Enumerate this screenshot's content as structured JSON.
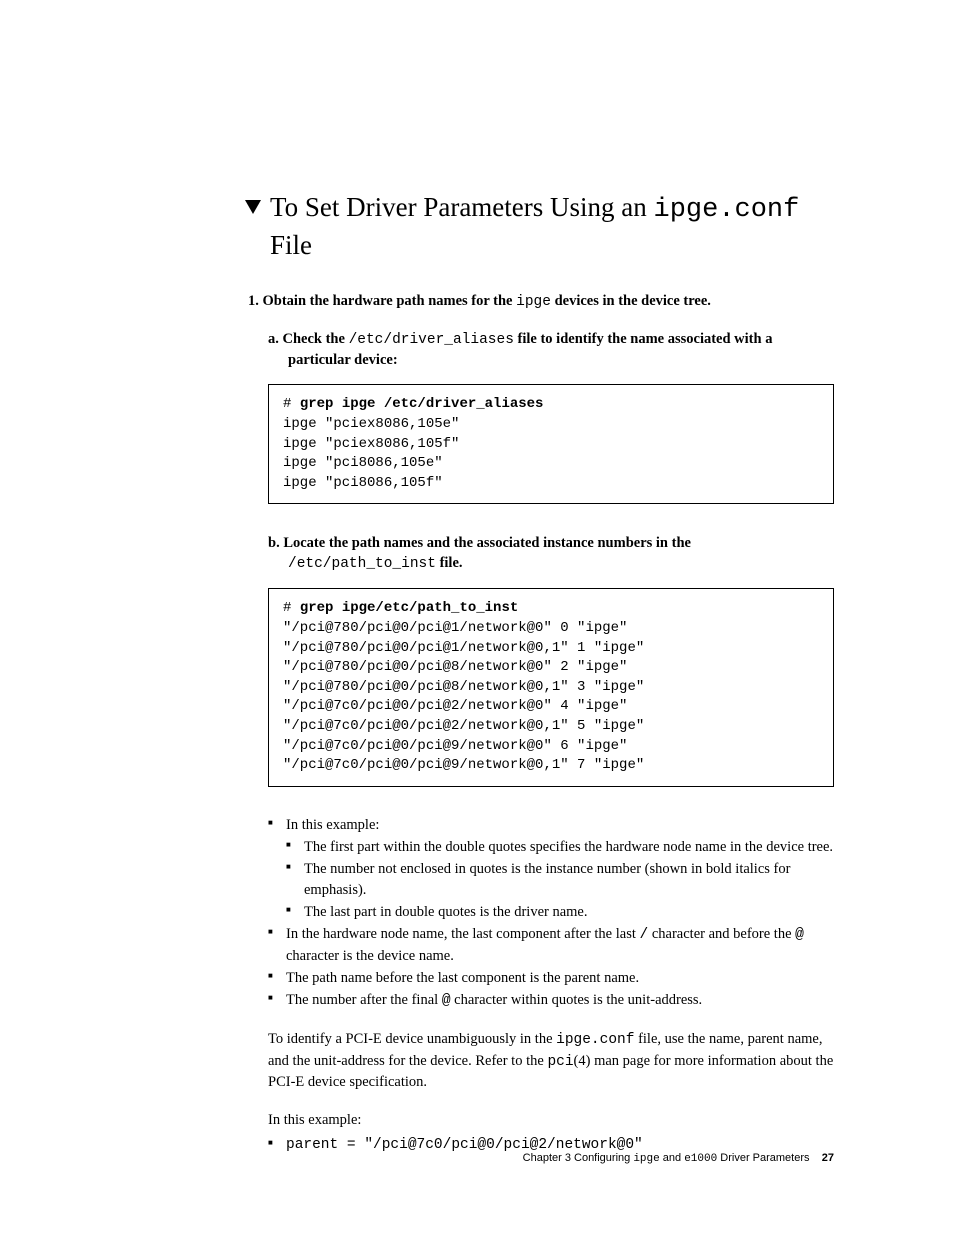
{
  "heading": {
    "pre": "To Set Driver Parameters Using an ",
    "tt": "ipge.conf",
    "post": " File"
  },
  "step1": {
    "num": "1.  ",
    "pre": "Obtain the hardware path names for the ",
    "tt": "ipge",
    "post": " devices in the device tree."
  },
  "sub_a": {
    "num": "a.  ",
    "pre": "Check the ",
    "tt": "/etc/driver_aliases",
    "post": " file to identify the name associated with a particular device:"
  },
  "code1": {
    "prompt": "# ",
    "cmd": "grep ipge /etc/driver_aliases",
    "out": "ipge \"pciex8086,105e\"\nipge \"pciex8086,105f\"\nipge \"pci8086,105e\"\nipge \"pci8086,105f\""
  },
  "sub_b": {
    "num": "b.  ",
    "line1": "Locate the path names and the associated instance numbers in the",
    "tt": "/etc/path_to_inst",
    "post": " file."
  },
  "code2": {
    "prompt": "# ",
    "cmd": "grep ipge/etc/path_to_inst",
    "out": "\"/pci@780/pci@0/pci@1/network@0\" 0 \"ipge\"\n\"/pci@780/pci@0/pci@1/network@0,1\" 1 \"ipge\"\n\"/pci@780/pci@0/pci@8/network@0\" 2 \"ipge\"\n\"/pci@780/pci@0/pci@8/network@0,1\" 3 \"ipge\"\n\"/pci@7c0/pci@0/pci@2/network@0\" 4 \"ipge\"\n\"/pci@7c0/pci@0/pci@2/network@0,1\" 5 \"ipge\"\n\"/pci@7c0/pci@0/pci@9/network@0\" 6 \"ipge\"\n\"/pci@7c0/pci@0/pci@9/network@0,1\" 7 \"ipge\""
  },
  "bullets": {
    "b1": "In this example:",
    "b1a": "The first part within the double quotes specifies the hardware node name in the device tree.",
    "b1b": "The number not enclosed in quotes is the instance number (shown in bold italics for emphasis).",
    "b1c": "The last part in double quotes is the driver name.",
    "b2_pre": "In the hardware node name, the last component after the last ",
    "b2_tt1": "/",
    "b2_mid": " character and before the ",
    "b2_tt2": "@",
    "b2_post": " character is the device name.",
    "b3": "The path name before the last component is the parent name.",
    "b4_pre": "The number after the final ",
    "b4_tt": "@",
    "b4_post": " character within quotes is the unit-address."
  },
  "para1": {
    "pre": "To identify a PCI-E device unambiguously in the ",
    "tt1": "ipge.conf",
    "mid": " file, use the name, parent name, and the unit-address for the device. Refer to the ",
    "tt2": "pci",
    "post": "(4) man page for more information about the PCI-E device specification."
  },
  "para2": "In this example:",
  "example_line": "parent = \"/pci@7c0/pci@0/pci@2/network@0\"",
  "footer": {
    "pre": "Chapter 3    Configuring ",
    "tt1": "ipge",
    "mid": " and ",
    "tt2": "e1000",
    "post": " Driver Parameters",
    "page": "27"
  }
}
